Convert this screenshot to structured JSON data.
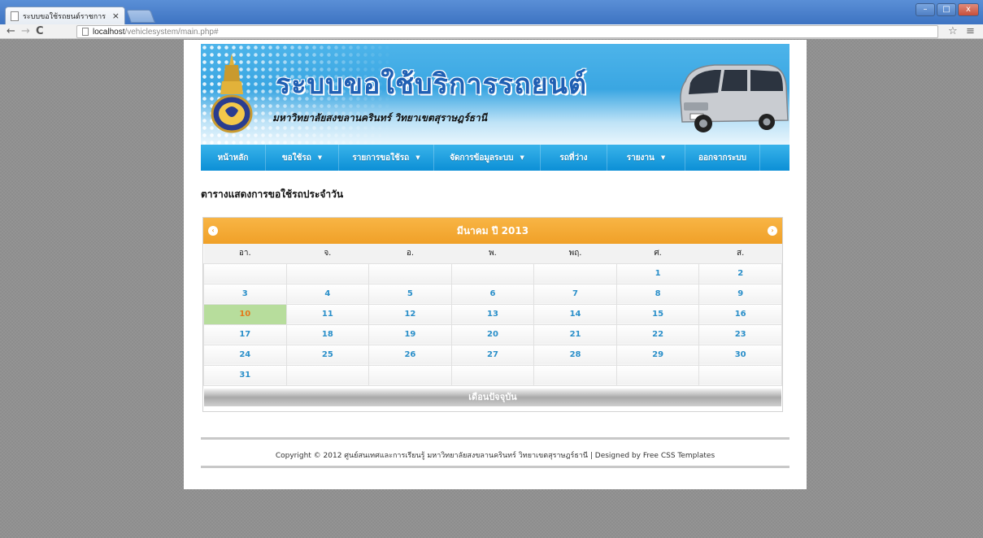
{
  "browser": {
    "tab_title": "ระบบขอใช้รถยนต์ราชการ มหา",
    "tab_close": "×",
    "url_host": "localhost",
    "url_path": "/vehiclesystem/main.php#",
    "back": "←",
    "forward": "→",
    "reload": "C",
    "star": "☆",
    "menu": "≡",
    "win_min": "–",
    "win_max": "□",
    "win_close": "x"
  },
  "banner": {
    "title": "ระบบขอใช้บริการรถยนต์",
    "subtitle": "มหาวิทยาลัยสงขลานครินทร์ วิทยาเขตสุราษฎร์ธานี"
  },
  "menu": [
    {
      "label": "หน้าหลัก",
      "dropdown": false
    },
    {
      "label": "ขอใช้รถ",
      "dropdown": true
    },
    {
      "label": "รายการขอใช้รถ",
      "dropdown": true
    },
    {
      "label": "จัดการข้อมูลระบบ",
      "dropdown": true
    },
    {
      "label": "รถที่ว่าง",
      "dropdown": false
    },
    {
      "label": "รายงาน",
      "dropdown": true
    },
    {
      "label": "ออกจากระบบ",
      "dropdown": false
    }
  ],
  "section_title": "ตารางแสดงการขอใช้รถประจำวัน",
  "calendar": {
    "month_label": "มีนาคม ปี 2013",
    "prev": "‹",
    "next": "›",
    "weekdays": [
      "อา.",
      "จ.",
      "อ.",
      "พ.",
      "พฤ.",
      "ศ.",
      "ส."
    ],
    "weeks": [
      [
        "",
        "",
        "",
        "",
        "",
        "1",
        "2"
      ],
      [
        "3",
        "4",
        "5",
        "6",
        "7",
        "8",
        "9"
      ],
      [
        "10",
        "11",
        "12",
        "13",
        "14",
        "15",
        "16"
      ],
      [
        "17",
        "18",
        "19",
        "20",
        "21",
        "22",
        "23"
      ],
      [
        "24",
        "25",
        "26",
        "27",
        "28",
        "29",
        "30"
      ],
      [
        "31",
        "",
        "",
        "",
        "",
        "",
        ""
      ]
    ],
    "today": "10",
    "current_month_button": "เดือนปัจจุบัน",
    "colors": {
      "header": "#f0a028",
      "today_bg": "#b7dd9c",
      "day_text": "#2a8fc9",
      "today_text": "#e37a1c"
    }
  },
  "footer": {
    "text": "Copyright © 2012 ศูนย์สนเทศและการเรียนรู้ มหาวิทยาลัยสงขลานครินทร์ วิทยาเขตสุราษฎร์ธานี | Designed by Free CSS Templates"
  },
  "colors": {
    "menubar": "#1a9ede",
    "background": "#8d8d8d"
  }
}
